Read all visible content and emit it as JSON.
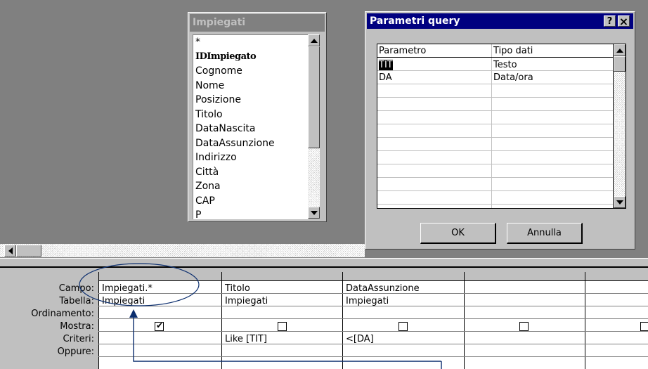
{
  "table_window": {
    "title": "Impiegati",
    "fields": [
      "*",
      "IDImpiegato",
      "Cognome",
      "Nome",
      "Posizione",
      "Titolo",
      "DataNascita",
      "DataAssunzione",
      "Indirizzo",
      "Città",
      "Zona",
      "CAP",
      "P"
    ]
  },
  "dialog": {
    "title": "Parametri query",
    "help_label": "?",
    "close_label": "×",
    "columns": [
      "Parametro",
      "Tipo dati"
    ],
    "rows": [
      {
        "param": "TIT",
        "type": "Testo"
      },
      {
        "param": "DA",
        "type": "Data/ora"
      }
    ],
    "ok_label": "OK",
    "cancel_label": "Annulla"
  },
  "grid": {
    "row_labels": {
      "campo": "Campo:",
      "tabella": "Tabella:",
      "ordinamento": "Ordinamento:",
      "mostra": "Mostra:",
      "criteri": "Criteri:",
      "oppure": "Oppure:"
    },
    "columns": [
      {
        "campo": "Impiegati.*",
        "tabella": "Impiegati",
        "mostra": true,
        "criteri": ""
      },
      {
        "campo": "Titolo",
        "tabella": "Impiegati",
        "mostra": false,
        "criteri": "Like [TIT]"
      },
      {
        "campo": "DataAssunzione",
        "tabella": "Impiegati",
        "mostra": false,
        "criteri": "<[DA]"
      },
      {
        "campo": "",
        "tabella": "",
        "mostra": false,
        "criteri": ""
      },
      {
        "campo": "",
        "tabella": "",
        "mostra": false,
        "criteri": ""
      }
    ]
  },
  "colors": {
    "title_active": "#000080",
    "title_inactive": "#808080",
    "annotation": "#0b2e6e"
  }
}
